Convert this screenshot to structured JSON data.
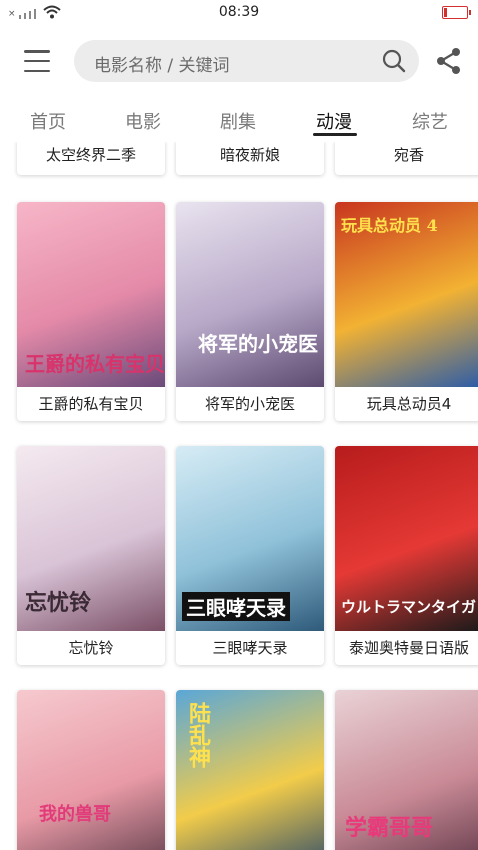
{
  "status_bar": {
    "time": "08:39",
    "signal_icon": "signal-icon",
    "wifi_icon": "wifi-icon",
    "battery_icon": "battery-low-icon",
    "battery_color": "#d32f2f"
  },
  "search": {
    "placeholder": "电影名称 / 关键词"
  },
  "tabs": [
    {
      "label": "首页",
      "active": false
    },
    {
      "label": "电影",
      "active": false
    },
    {
      "label": "剧集",
      "active": false
    },
    {
      "label": "动漫",
      "active": true
    },
    {
      "label": "综艺",
      "active": false
    }
  ],
  "top_row_titles": [
    "太空终界二季",
    "暗夜新娘",
    "宛香"
  ],
  "cards": [
    {
      "title": "王爵的私有宝贝",
      "poster_text": "王爵的私有宝贝",
      "colors": [
        "#f7b6c8",
        "#e48aa8",
        "#6a4a7a"
      ]
    },
    {
      "title": "将军的小宠医",
      "poster_text": "将军的小宠医",
      "colors": [
        "#e9e3ef",
        "#b7a8c8",
        "#5d4a70"
      ]
    },
    {
      "title": "玩具总动员4",
      "poster_text": "玩具总动员 4",
      "colors": [
        "#c8351f",
        "#f2b233",
        "#2c5ca8"
      ]
    },
    {
      "title": "忘忧铃",
      "poster_text": "忘忧铃",
      "colors": [
        "#f5eaf0",
        "#d9c3d6",
        "#7b5067"
      ]
    },
    {
      "title": "三眼哮天录",
      "poster_text": "三眼哮天录",
      "colors": [
        "#d6ecf5",
        "#8fc1d9",
        "#2f5a7a"
      ]
    },
    {
      "title": "泰迦奥特曼日语版",
      "poster_text": "ウルトラマンタイガ",
      "colors": [
        "#b71c1c",
        "#e53935",
        "#1a1a1a"
      ]
    },
    {
      "title": "",
      "poster_text": "我的兽哥",
      "colors": [
        "#f6c9cf",
        "#e89aa6",
        "#5b3a48"
      ]
    },
    {
      "title": "",
      "poster_text": "陆乱神",
      "colors": [
        "#5aa7d8",
        "#f2cc4a",
        "#2b4a6a"
      ]
    },
    {
      "title": "",
      "poster_text": "学霸哥哥",
      "colors": [
        "#e9d2d6",
        "#c98a96",
        "#5a3344"
      ]
    }
  ]
}
